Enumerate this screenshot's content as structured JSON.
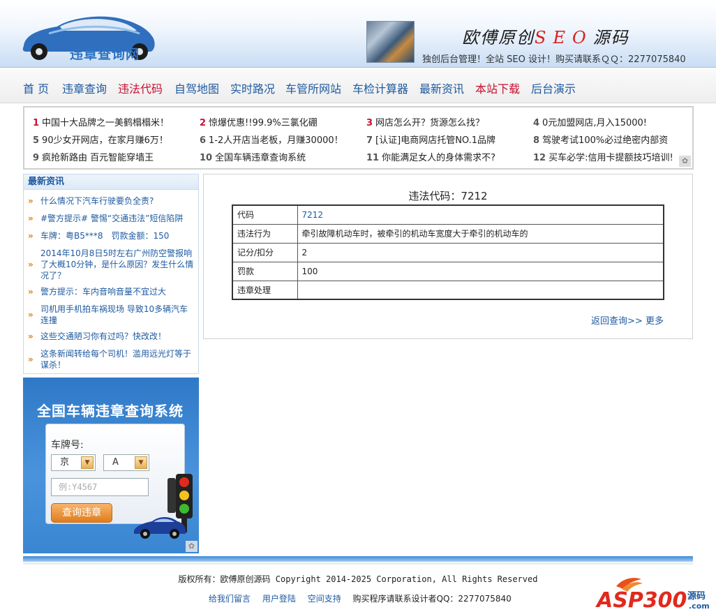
{
  "header": {
    "logo_text": "违章查询网",
    "brand_a": "欧傅原创",
    "brand_b": "SEO",
    "brand_c": "源码",
    "subtitle": "独创后台管理！全站 SEO 设计！购买请联系ＱＱ：2277075840"
  },
  "nav": [
    {
      "label": "首 页",
      "active": false
    },
    {
      "label": "违章查询",
      "active": false
    },
    {
      "label": "违法代码",
      "active": true
    },
    {
      "label": "自驾地图",
      "active": false
    },
    {
      "label": "实时路况",
      "active": false
    },
    {
      "label": "车管所网站",
      "active": false
    },
    {
      "label": "车检计算器",
      "active": false
    },
    {
      "label": "最新资讯",
      "active": false
    },
    {
      "label": "本站下载",
      "active": true
    },
    {
      "label": "后台演示",
      "active": false
    }
  ],
  "ads": [
    {
      "num": "1",
      "text": "中国十大品牌之一美鹤榻榻米！"
    },
    {
      "num": "2",
      "text": "惊爆优惠!!99.9%三氯化硼"
    },
    {
      "num": "3",
      "text": "网店怎么开？货源怎么找？"
    },
    {
      "num": "4",
      "text": "0元加盟网店,月入15000!"
    },
    {
      "num": "5",
      "text": "90少女开网店，在家月赚6万！"
    },
    {
      "num": "6",
      "text": "1-2人开店当老板，月赚30000！"
    },
    {
      "num": "7",
      "text": "[认证]电商网店托管NO.1品牌"
    },
    {
      "num": "8",
      "text": "驾驶考试100%必过绝密内部资"
    },
    {
      "num": "9",
      "text": "疯抢新路由 百元智能穿墙王"
    },
    {
      "num": "10",
      "text": "全国车辆违章查询系统"
    },
    {
      "num": "11",
      "text": "你能满足女人的身体需求不?"
    },
    {
      "num": "12",
      "text": "买车必学:信用卡提额技巧培训!"
    }
  ],
  "news": {
    "title": "最新资讯",
    "items": [
      "什么情况下汽车行驶要负全责?",
      "#警方提示# 警惕“交通违法”短信陷阱",
      "车牌：粤B5***8　罚款金额：150",
      "2014年10月8日5时左右广州防空警报响了大概10分钟，是什么原因？发生什么情况了？",
      "警方提示：车内音响音量不宜过大",
      "司机用手机拍车祸现场 导致10多辆汽车连撞",
      "这些交通陋习你有过吗？快改改！",
      "这条新闻转给每个司机！滥用远光灯等于谋杀！"
    ]
  },
  "query": {
    "title": "全国车辆违章查询系统",
    "plate_label": "车牌号:",
    "province": "京",
    "letter": "A",
    "placeholder": "例:Y4567",
    "button": "查询违章"
  },
  "detail": {
    "title": "违法代码：7212",
    "rows": [
      {
        "key": "代码",
        "value": "7212"
      },
      {
        "key": "违法行为",
        "value": "牵引故障机动车时，被牵引的机动车宽度大于牵引的机动车的"
      },
      {
        "key": "记分/扣分",
        "value": "2"
      },
      {
        "key": "罚款",
        "value": "100"
      },
      {
        "key": "违章处理",
        "value": ""
      }
    ],
    "back_link": "返回查询>>",
    "more_link": "更多"
  },
  "footer": {
    "copyright": "版权所有：欧傅原创源码 Copyright 2014-2025 Corporation, All Rights Reserved",
    "links": [
      "给我们留言",
      "用户登陆",
      "空间支持"
    ],
    "contact": "购买程序请联系设计者QQ：2277075840",
    "badge_text": "ASP300",
    "badge_sub": "源码",
    "badge_domain": ".com"
  }
}
